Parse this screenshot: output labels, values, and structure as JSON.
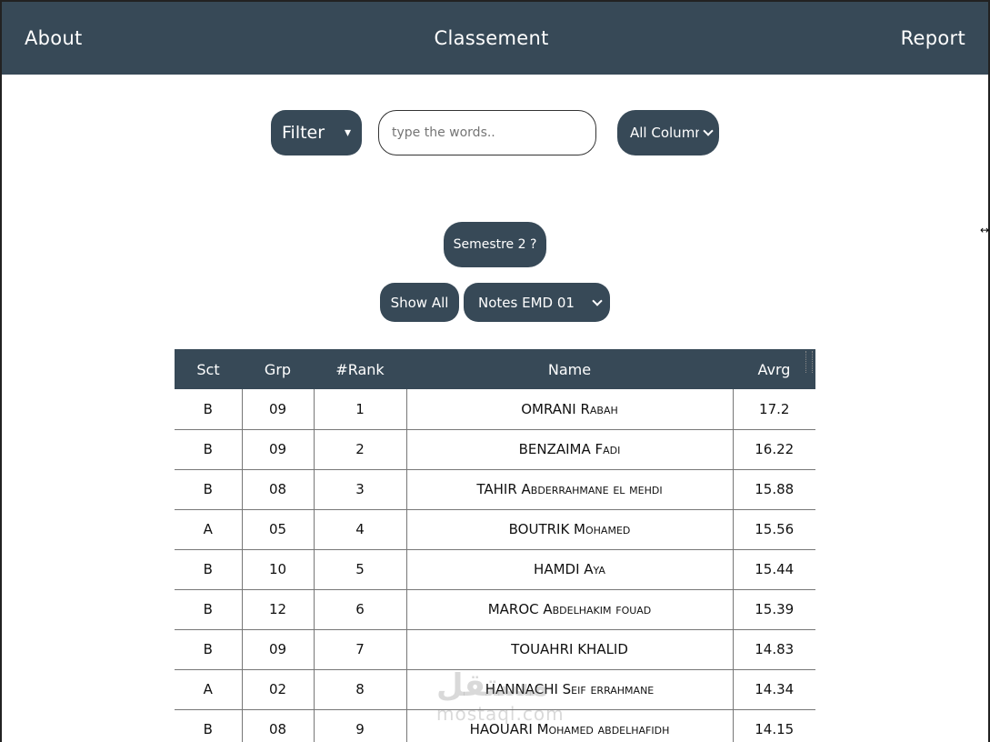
{
  "nav": {
    "about": "About",
    "title": "Classement",
    "report": "Report"
  },
  "filters": {
    "filter_label": "Filter",
    "filter_caret": "▾",
    "search_placeholder": "type the words..",
    "columns_selected": "All Columns"
  },
  "semestre_label": "Semestre 2 ?",
  "show_all_label": "Show All",
  "notes_selected": "Notes EMD 01",
  "table": {
    "headers": [
      "Sct",
      "Grp",
      "#Rank",
      "Name",
      "Avrg"
    ],
    "rows": [
      [
        "B",
        "09",
        "1",
        "OMRANI Rabah",
        "17.2"
      ],
      [
        "B",
        "09",
        "2",
        "BENZAIMA Fadi",
        "16.22"
      ],
      [
        "B",
        "08",
        "3",
        "TAHIR Abderrahmane el mehdi",
        "15.88"
      ],
      [
        "A",
        "05",
        "4",
        "BOUTRIK Mohamed",
        "15.56"
      ],
      [
        "B",
        "10",
        "5",
        "HAMDI Aya",
        "15.44"
      ],
      [
        "B",
        "12",
        "6",
        "MAROC Abdelhakim fouad",
        "15.39"
      ],
      [
        "B",
        "09",
        "7",
        "TOUAHRI KHALID",
        "14.83"
      ],
      [
        "A",
        "02",
        "8",
        "HANNACHI Seif errahmane",
        "14.34"
      ],
      [
        "B",
        "08",
        "9",
        "HAOUARI Mohamed abdelhafidh",
        "14.15"
      ]
    ]
  },
  "watermark": {
    "arabic": "مستقل",
    "latin": "mostaql.com"
  },
  "colors": {
    "primary": "#374957"
  }
}
